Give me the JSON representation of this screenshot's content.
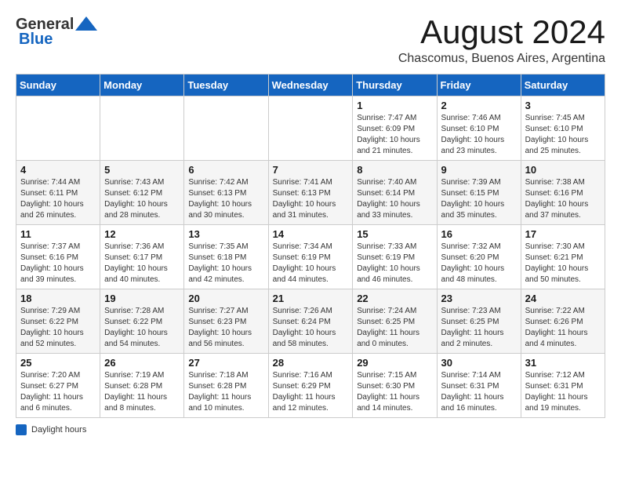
{
  "header": {
    "logo_general": "General",
    "logo_blue": "Blue",
    "month_year": "August 2024",
    "location": "Chascomus, Buenos Aires, Argentina"
  },
  "footer": {
    "label": "Daylight hours"
  },
  "weekdays": [
    "Sunday",
    "Monday",
    "Tuesday",
    "Wednesday",
    "Thursday",
    "Friday",
    "Saturday"
  ],
  "weeks": [
    [
      {
        "day": "",
        "info": ""
      },
      {
        "day": "",
        "info": ""
      },
      {
        "day": "",
        "info": ""
      },
      {
        "day": "",
        "info": ""
      },
      {
        "day": "1",
        "info": "Sunrise: 7:47 AM\nSunset: 6:09 PM\nDaylight: 10 hours\nand 21 minutes."
      },
      {
        "day": "2",
        "info": "Sunrise: 7:46 AM\nSunset: 6:10 PM\nDaylight: 10 hours\nand 23 minutes."
      },
      {
        "day": "3",
        "info": "Sunrise: 7:45 AM\nSunset: 6:10 PM\nDaylight: 10 hours\nand 25 minutes."
      }
    ],
    [
      {
        "day": "4",
        "info": "Sunrise: 7:44 AM\nSunset: 6:11 PM\nDaylight: 10 hours\nand 26 minutes."
      },
      {
        "day": "5",
        "info": "Sunrise: 7:43 AM\nSunset: 6:12 PM\nDaylight: 10 hours\nand 28 minutes."
      },
      {
        "day": "6",
        "info": "Sunrise: 7:42 AM\nSunset: 6:13 PM\nDaylight: 10 hours\nand 30 minutes."
      },
      {
        "day": "7",
        "info": "Sunrise: 7:41 AM\nSunset: 6:13 PM\nDaylight: 10 hours\nand 31 minutes."
      },
      {
        "day": "8",
        "info": "Sunrise: 7:40 AM\nSunset: 6:14 PM\nDaylight: 10 hours\nand 33 minutes."
      },
      {
        "day": "9",
        "info": "Sunrise: 7:39 AM\nSunset: 6:15 PM\nDaylight: 10 hours\nand 35 minutes."
      },
      {
        "day": "10",
        "info": "Sunrise: 7:38 AM\nSunset: 6:16 PM\nDaylight: 10 hours\nand 37 minutes."
      }
    ],
    [
      {
        "day": "11",
        "info": "Sunrise: 7:37 AM\nSunset: 6:16 PM\nDaylight: 10 hours\nand 39 minutes."
      },
      {
        "day": "12",
        "info": "Sunrise: 7:36 AM\nSunset: 6:17 PM\nDaylight: 10 hours\nand 40 minutes."
      },
      {
        "day": "13",
        "info": "Sunrise: 7:35 AM\nSunset: 6:18 PM\nDaylight: 10 hours\nand 42 minutes."
      },
      {
        "day": "14",
        "info": "Sunrise: 7:34 AM\nSunset: 6:19 PM\nDaylight: 10 hours\nand 44 minutes."
      },
      {
        "day": "15",
        "info": "Sunrise: 7:33 AM\nSunset: 6:19 PM\nDaylight: 10 hours\nand 46 minutes."
      },
      {
        "day": "16",
        "info": "Sunrise: 7:32 AM\nSunset: 6:20 PM\nDaylight: 10 hours\nand 48 minutes."
      },
      {
        "day": "17",
        "info": "Sunrise: 7:30 AM\nSunset: 6:21 PM\nDaylight: 10 hours\nand 50 minutes."
      }
    ],
    [
      {
        "day": "18",
        "info": "Sunrise: 7:29 AM\nSunset: 6:22 PM\nDaylight: 10 hours\nand 52 minutes."
      },
      {
        "day": "19",
        "info": "Sunrise: 7:28 AM\nSunset: 6:22 PM\nDaylight: 10 hours\nand 54 minutes."
      },
      {
        "day": "20",
        "info": "Sunrise: 7:27 AM\nSunset: 6:23 PM\nDaylight: 10 hours\nand 56 minutes."
      },
      {
        "day": "21",
        "info": "Sunrise: 7:26 AM\nSunset: 6:24 PM\nDaylight: 10 hours\nand 58 minutes."
      },
      {
        "day": "22",
        "info": "Sunrise: 7:24 AM\nSunset: 6:25 PM\nDaylight: 11 hours\nand 0 minutes."
      },
      {
        "day": "23",
        "info": "Sunrise: 7:23 AM\nSunset: 6:25 PM\nDaylight: 11 hours\nand 2 minutes."
      },
      {
        "day": "24",
        "info": "Sunrise: 7:22 AM\nSunset: 6:26 PM\nDaylight: 11 hours\nand 4 minutes."
      }
    ],
    [
      {
        "day": "25",
        "info": "Sunrise: 7:20 AM\nSunset: 6:27 PM\nDaylight: 11 hours\nand 6 minutes."
      },
      {
        "day": "26",
        "info": "Sunrise: 7:19 AM\nSunset: 6:28 PM\nDaylight: 11 hours\nand 8 minutes."
      },
      {
        "day": "27",
        "info": "Sunrise: 7:18 AM\nSunset: 6:28 PM\nDaylight: 11 hours\nand 10 minutes."
      },
      {
        "day": "28",
        "info": "Sunrise: 7:16 AM\nSunset: 6:29 PM\nDaylight: 11 hours\nand 12 minutes."
      },
      {
        "day": "29",
        "info": "Sunrise: 7:15 AM\nSunset: 6:30 PM\nDaylight: 11 hours\nand 14 minutes."
      },
      {
        "day": "30",
        "info": "Sunrise: 7:14 AM\nSunset: 6:31 PM\nDaylight: 11 hours\nand 16 minutes."
      },
      {
        "day": "31",
        "info": "Sunrise: 7:12 AM\nSunset: 6:31 PM\nDaylight: 11 hours\nand 19 minutes."
      }
    ]
  ]
}
